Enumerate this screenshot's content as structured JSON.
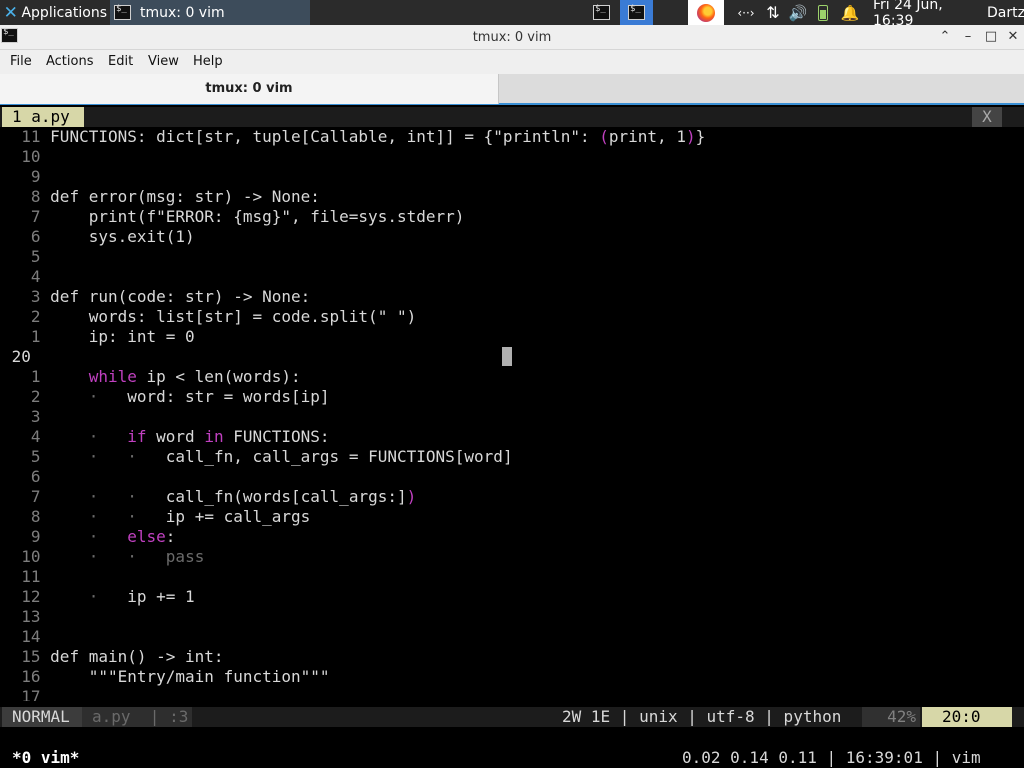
{
  "panel": {
    "apps_label": "Applications",
    "task_label": "tmux: 0 vim",
    "clock": "Fri 24 Jun, 16:39",
    "user": "Dartz",
    "net_glyph": "‹··›",
    "xfer_glyph": "⇅",
    "volume_glyph": "🔊",
    "bell_glyph": "🔔"
  },
  "window": {
    "title": "tmux: 0 vim",
    "up_glyph": "⌃",
    "min_glyph": "–",
    "max_glyph": "□",
    "close_glyph": "✕"
  },
  "menubar": {
    "items": [
      "File",
      "Actions",
      "Edit",
      "View",
      "Help"
    ]
  },
  "tab": {
    "label": "tmux: 0 vim"
  },
  "vim": {
    "buffer_tab": "1 a.py",
    "buffer_close": "X",
    "status": {
      "mode": "NORMAL",
      "file": "a.py  | :3",
      "info": "2W 1E | unix | utf-8 | python",
      "percent": "42%",
      "position": "20:0"
    }
  },
  "tmux": {
    "window": "*0 vim*",
    "right": "0.02 0.14 0.11 | 16:39:01 | vim"
  },
  "colors": {
    "panel_bg": "#2b2b2b",
    "task_active": "#3d4c5b",
    "accent": "#3a8fd4",
    "vim_tab_active": "#d7d7a8",
    "vim_keyword_paren": "#c040c0"
  }
}
